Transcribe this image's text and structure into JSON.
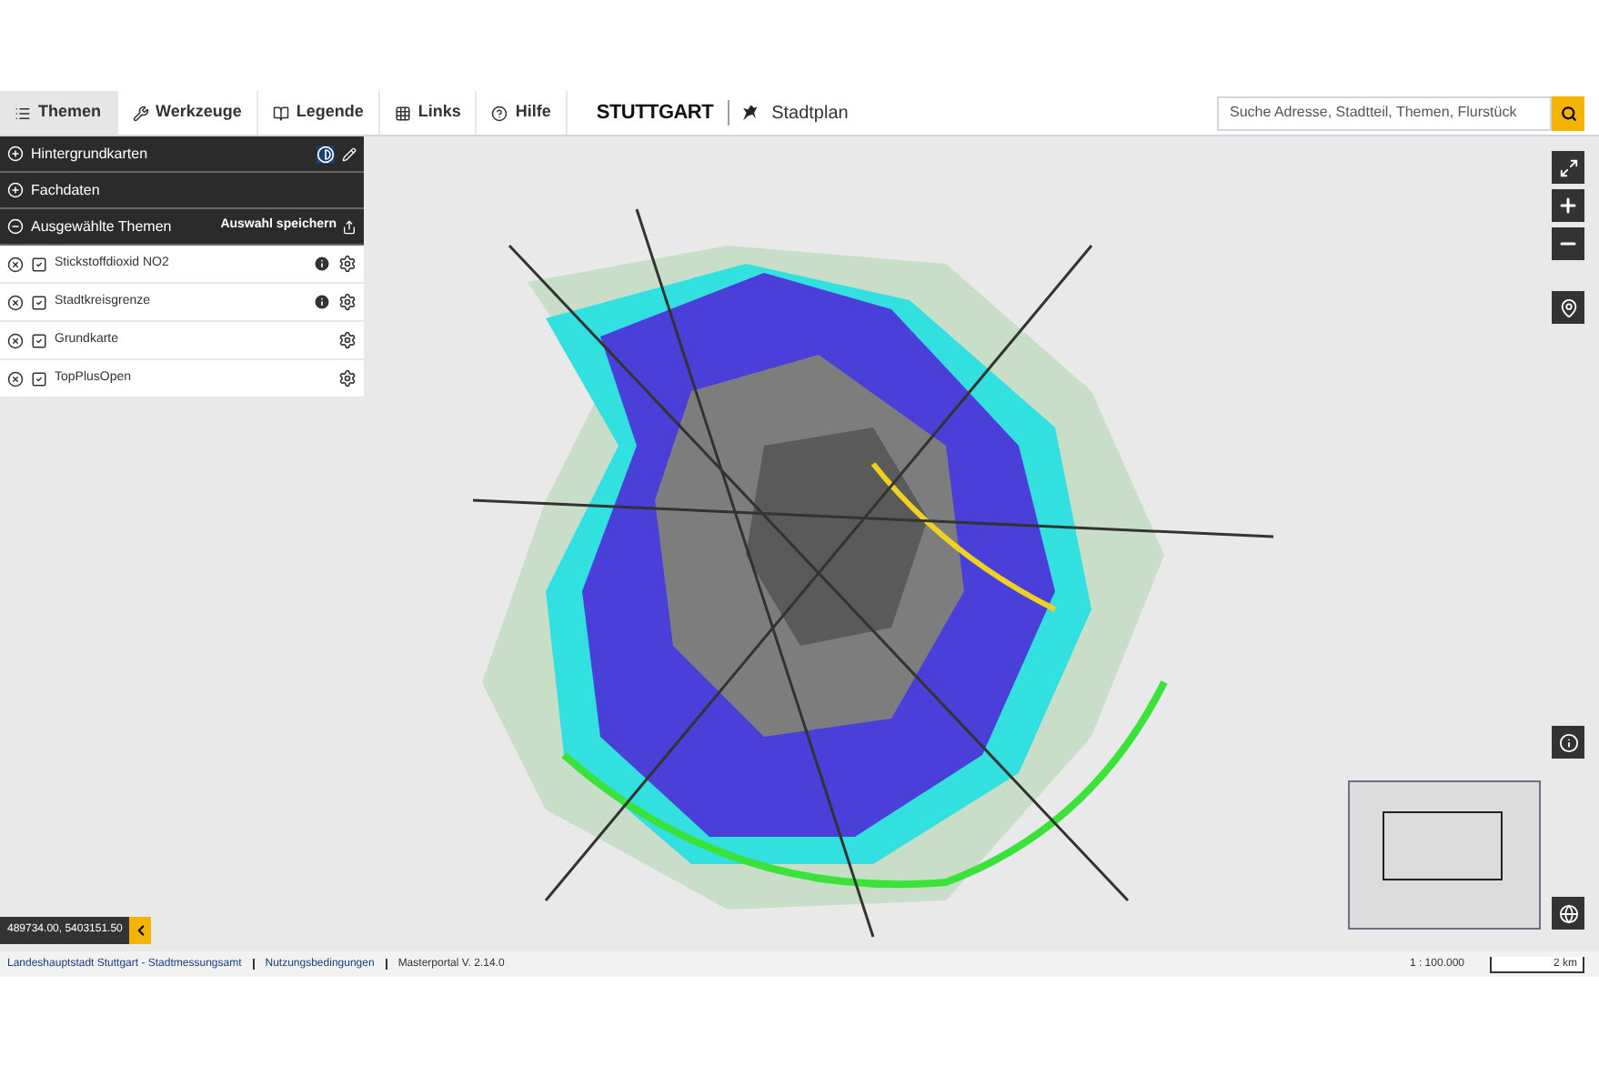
{
  "toolbar": {
    "tabs": [
      {
        "label": "Themen",
        "selected": true
      },
      {
        "label": "Werkzeuge",
        "selected": false
      },
      {
        "label": "Legende",
        "selected": false
      },
      {
        "label": "Links",
        "selected": false
      },
      {
        "label": "Hilfe",
        "selected": false
      }
    ],
    "logo": "STUTTGART",
    "app_title": "Stadtplan",
    "search": {
      "placeholder": "Suche Adresse, Stadtteil, Themen, Flurstück"
    }
  },
  "layer_panel": {
    "sections": [
      {
        "label": "Hintergrundkarten",
        "expanded": false
      },
      {
        "label": "Fachdaten",
        "expanded": false
      },
      {
        "label": "Ausgewählte Themen",
        "expanded": true,
        "action": "Auswahl speichern"
      }
    ],
    "themes": [
      {
        "name": "Stickstoffdioxid NO2",
        "checked": true,
        "info": true
      },
      {
        "name": "Stadtkreisgrenze",
        "checked": true,
        "info": true
      },
      {
        "name": "Grundkarte",
        "checked": true,
        "info": false
      },
      {
        "name": "TopPlusOpen",
        "checked": true,
        "info": false
      }
    ]
  },
  "coordinates": "489734.00, 5403151.50",
  "status_bar": {
    "links": [
      "Landeshauptstadt Stuttgart - Stadtmessungsamt",
      "Nutzungsbedingungen"
    ],
    "version": "Masterportal V. 2.14.0",
    "scale": "1 : 100.000",
    "scale_bar": "2 km"
  }
}
